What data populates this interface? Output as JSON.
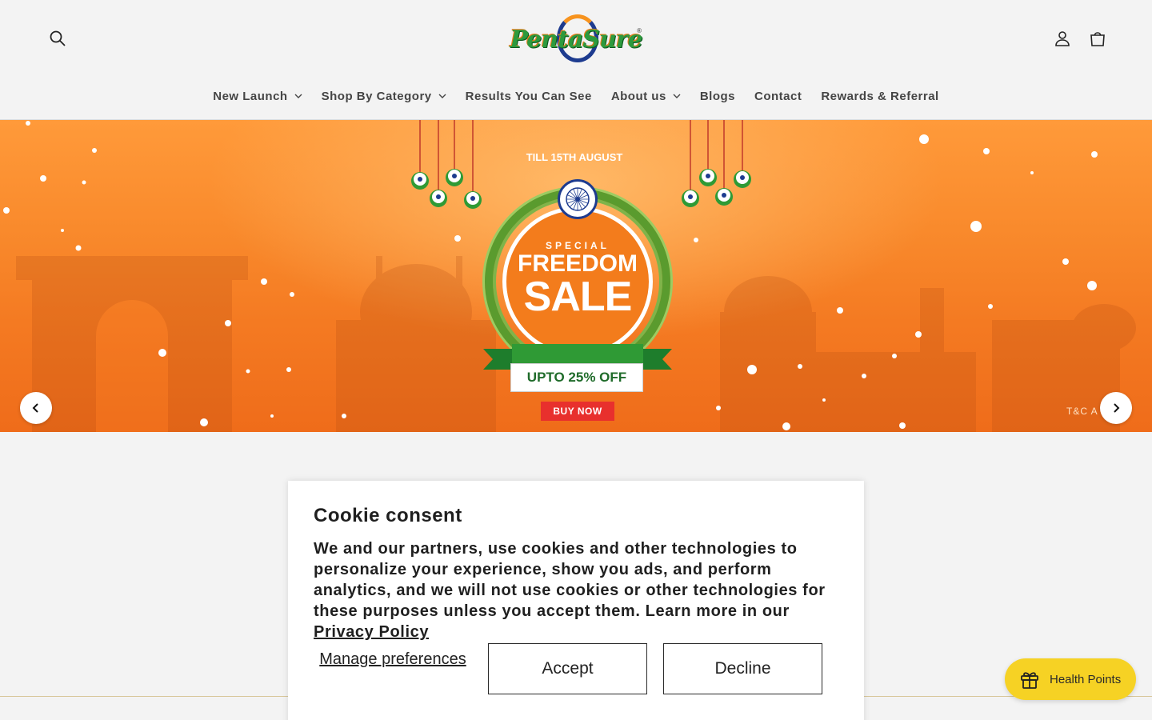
{
  "header": {
    "logo_text": "PentaSure",
    "logo_reg": "®",
    "search_icon": "search-icon",
    "account_icon": "user-icon",
    "cart_icon": "cart-icon"
  },
  "nav": {
    "items": [
      {
        "label": "New Launch",
        "dropdown": true
      },
      {
        "label": "Shop By Category",
        "dropdown": true
      },
      {
        "label": "Results You Can See",
        "dropdown": false
      },
      {
        "label": "About us",
        "dropdown": true
      },
      {
        "label": "Blogs",
        "dropdown": false
      },
      {
        "label": "Contact",
        "dropdown": false
      },
      {
        "label": "Rewards & Referral",
        "dropdown": false
      }
    ]
  },
  "hero": {
    "special": "SPECIAL",
    "freedom": "FREEDOM",
    "sale": "SALE",
    "till": "TILL 15TH AUGUST",
    "upto": "UPTO 25% OFF",
    "buy_now": "BUY NOW",
    "tc": "T&C A",
    "colors": {
      "orange": "#f37c1c",
      "green": "#2f9a35",
      "red": "#e8302d",
      "navy": "#1d3b8f"
    }
  },
  "cookie": {
    "title": "Cookie consent",
    "body": "We and our partners, use cookies and other technologies to personalize your experience, show you ads, and perform analytics, and we will not use cookies or other technologies for these purposes unless you accept them. Learn more in our ",
    "policy_link": "Privacy Policy",
    "manage": "Manage preferences",
    "accept": "Accept",
    "decline": "Decline"
  },
  "rewards": {
    "label": "Health Points",
    "icon": "gift-icon",
    "color": "#f6d224"
  }
}
